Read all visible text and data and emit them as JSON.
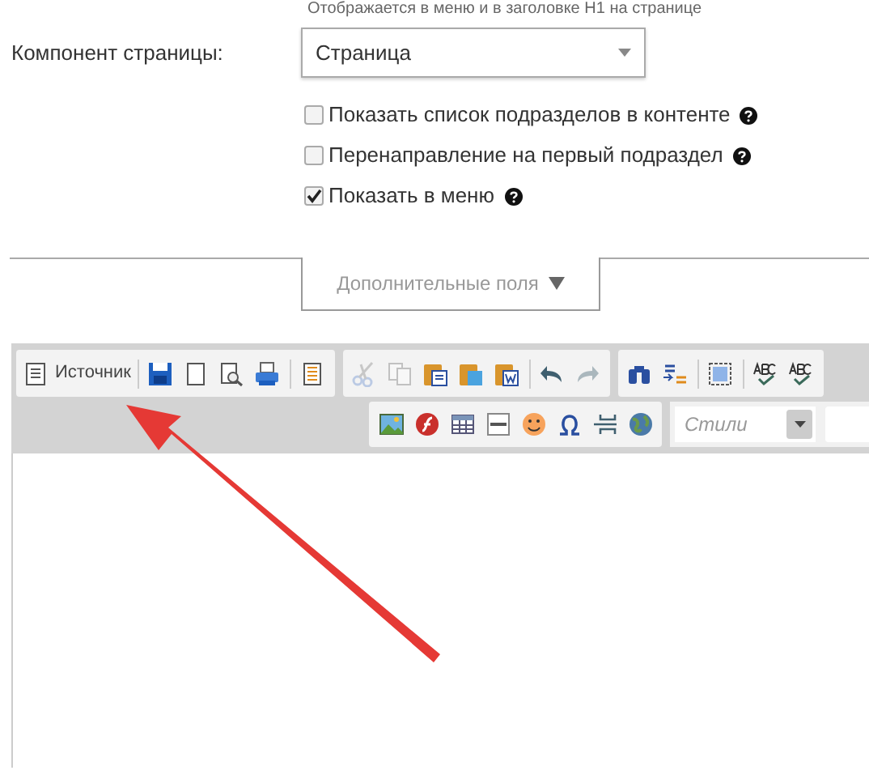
{
  "hint": "Отображается в меню и в заголовке H1 на странице",
  "component": {
    "label": "Компонент страницы:",
    "value": "Страница"
  },
  "options": [
    {
      "label": "Показать список подразделов в контенте",
      "checked": false
    },
    {
      "label": "Перенаправление на первый подраздел",
      "checked": false
    },
    {
      "label": "Показать в меню",
      "checked": true
    }
  ],
  "extra_fields": {
    "label": "Дополнительные поля",
    "expanded": false
  },
  "toolbar": {
    "row_1": [
      {
        "items": [
          {
            "kind": "source",
            "label": "Источник",
            "disabled": false
          },
          {
            "kind": "sep"
          },
          {
            "kind": "save",
            "disabled": false
          },
          {
            "kind": "newpage",
            "disabled": false
          },
          {
            "kind": "preview",
            "disabled": false
          },
          {
            "kind": "print",
            "disabled": false
          },
          {
            "kind": "sep"
          },
          {
            "kind": "templates",
            "disabled": false
          }
        ]
      },
      {
        "items": [
          {
            "kind": "cut",
            "disabled": true
          },
          {
            "kind": "copy",
            "disabled": true
          },
          {
            "kind": "paste",
            "disabled": false
          },
          {
            "kind": "pastetext",
            "disabled": false
          },
          {
            "kind": "pasteword",
            "disabled": false
          },
          {
            "kind": "sep"
          },
          {
            "kind": "undo",
            "disabled": false
          },
          {
            "kind": "redo",
            "disabled": true
          }
        ]
      },
      {
        "items": [
          {
            "kind": "find",
            "disabled": false
          },
          {
            "kind": "replace",
            "disabled": false
          },
          {
            "kind": "sep"
          },
          {
            "kind": "selectall",
            "disabled": false
          },
          {
            "kind": "sep"
          },
          {
            "kind": "spell",
            "disabled": false
          },
          {
            "kind": "spell",
            "disabled": false
          }
        ]
      }
    ],
    "row_2": [
      {
        "items": [
          {
            "kind": "image",
            "disabled": false
          },
          {
            "kind": "flash",
            "disabled": false
          },
          {
            "kind": "table",
            "disabled": false
          },
          {
            "kind": "hr",
            "disabled": false
          },
          {
            "kind": "smiley",
            "disabled": false
          },
          {
            "kind": "specialchar",
            "disabled": false
          },
          {
            "kind": "pagebreak",
            "disabled": false
          },
          {
            "kind": "iframe",
            "disabled": false
          }
        ]
      }
    ],
    "styles": {
      "placeholder": "Стили"
    }
  }
}
